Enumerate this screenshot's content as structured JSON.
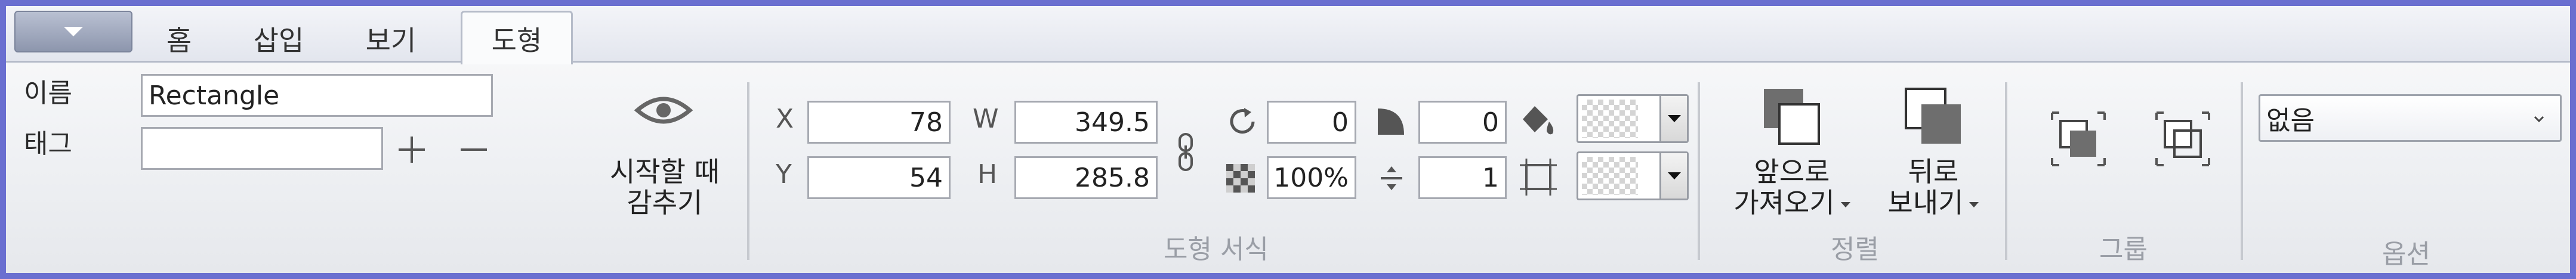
{
  "tabs": [
    "홈",
    "삽입",
    "보기",
    "도형"
  ],
  "active_tab": "도형",
  "name": {
    "label": "이름",
    "value": "Rectangle"
  },
  "tag": {
    "label": "태그",
    "value": ""
  },
  "hide_at_start": {
    "label_line1": "시작할 때",
    "label_line2": "감추기"
  },
  "position": {
    "x_label": "X",
    "x": "78",
    "y_label": "Y",
    "y": "54"
  },
  "size": {
    "w_label": "W",
    "w": "349.5",
    "h_label": "H",
    "h": "285.8"
  },
  "rotation": "0",
  "opacity": "100%",
  "corner": "0",
  "line_spacing": "1",
  "groups": {
    "shape_format": "도형 서식",
    "arrange": "정렬",
    "group": "그룹",
    "options": "옵션"
  },
  "bring_forward": {
    "line1": "앞으로",
    "line2": "가져오기"
  },
  "send_backward": {
    "line1": "뒤로",
    "line2": "보내기"
  },
  "options_select": {
    "value": "없음"
  }
}
